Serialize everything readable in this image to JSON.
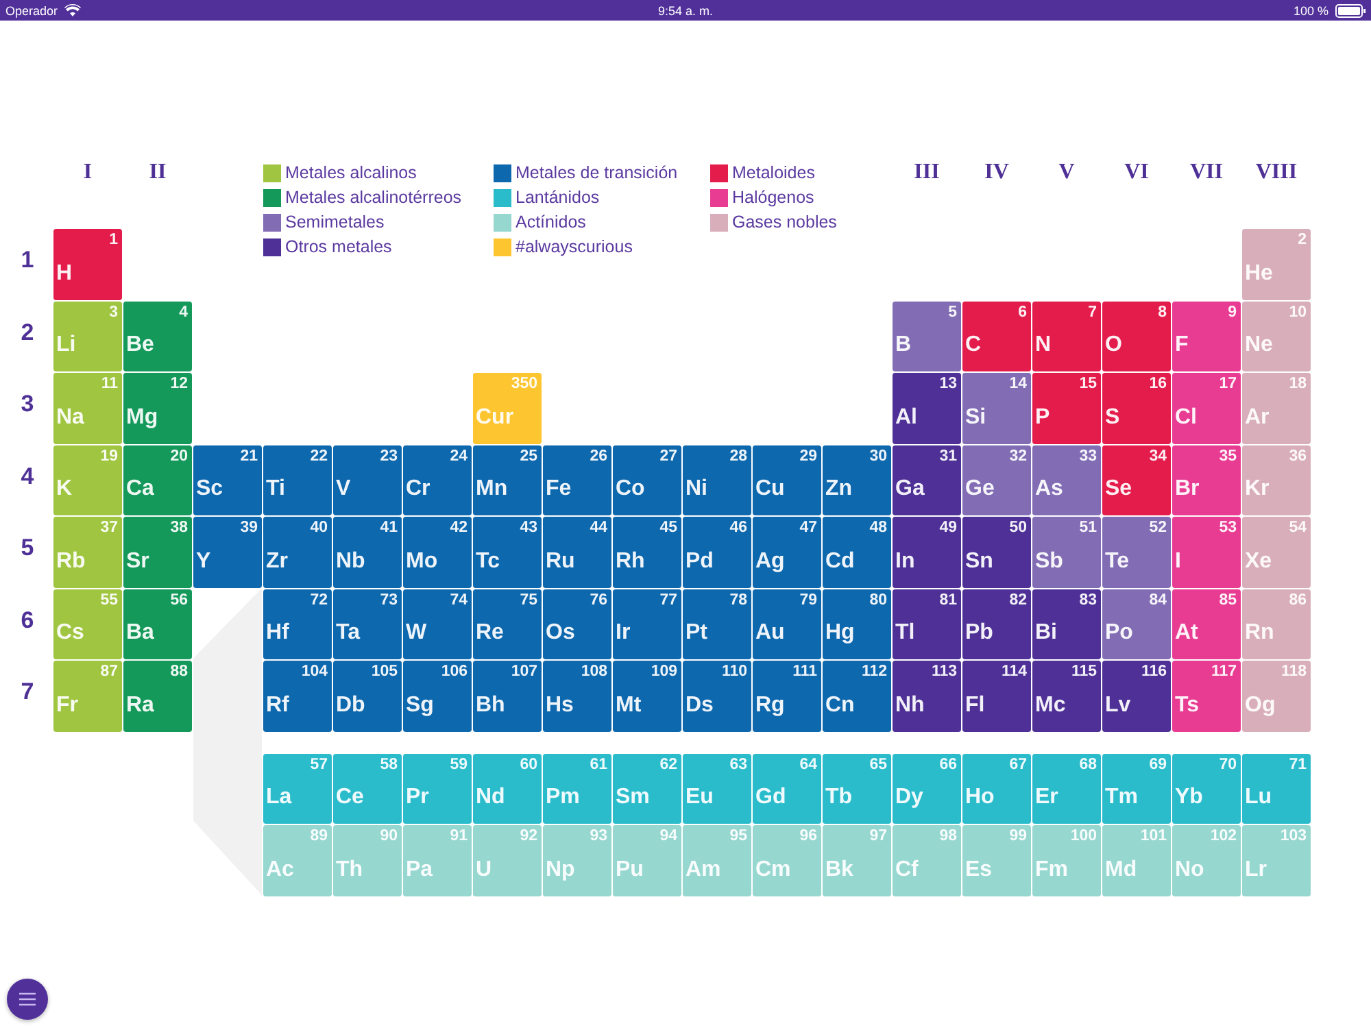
{
  "status_bar": {
    "carrier": "Operador",
    "time": "9:54 a. m.",
    "battery": "100 %"
  },
  "group_labels": {
    "left": [
      "I",
      "II"
    ],
    "right": [
      "III",
      "IV",
      "V",
      "VI",
      "VII",
      "VIII"
    ]
  },
  "legend": [
    {
      "kind": "alkali",
      "label": "Metales alcalinos",
      "color": "#a0c540"
    },
    {
      "kind": "alkaline",
      "label": "Metales alcalinotérreos",
      "color": "#14995b"
    },
    {
      "kind": "semimetal",
      "label": "Semimetales",
      "color": "#826db5"
    },
    {
      "kind": "other",
      "label": "Otros metales",
      "color": "#4e3096"
    },
    {
      "kind": "transition",
      "label": "Metales de transición",
      "color": "#0e68ae"
    },
    {
      "kind": "lanthanide",
      "label": "Lantánidos",
      "color": "#2bbccc"
    },
    {
      "kind": "actinide",
      "label": "Actínidos",
      "color": "#96d7d0"
    },
    {
      "kind": "curious",
      "label": "#alwayscurious",
      "color": "#fdc530"
    },
    {
      "kind": "metalloid",
      "label": "Metaloides",
      "color": "#e41c4c"
    },
    {
      "kind": "halogen",
      "label": "Halógenos",
      "color": "#e83c93"
    },
    {
      "kind": "noble",
      "label": "Gases nobles",
      "color": "#d9aebb"
    }
  ],
  "periods": [
    {
      "label": "1",
      "s_block": [
        {
          "symbol": "H",
          "number": "1",
          "kind": "metalloid"
        }
      ],
      "p_block": [
        {
          "symbol": "He",
          "number": "2",
          "kind": "noble"
        }
      ]
    },
    {
      "label": "2",
      "s_block": [
        {
          "symbol": "Li",
          "number": "3",
          "kind": "alkali"
        },
        {
          "symbol": "Be",
          "number": "4",
          "kind": "alkaline"
        }
      ],
      "p_block": [
        {
          "symbol": "B",
          "number": "5",
          "kind": "semimetal"
        },
        {
          "symbol": "C",
          "number": "6",
          "kind": "metalloid"
        },
        {
          "symbol": "N",
          "number": "7",
          "kind": "metalloid"
        },
        {
          "symbol": "O",
          "number": "8",
          "kind": "metalloid"
        },
        {
          "symbol": "F",
          "number": "9",
          "kind": "halogen"
        },
        {
          "symbol": "Ne",
          "number": "10",
          "kind": "noble"
        }
      ]
    },
    {
      "label": "3",
      "s_block": [
        {
          "symbol": "Na",
          "number": "11",
          "kind": "alkali"
        },
        {
          "symbol": "Mg",
          "number": "12",
          "kind": "alkaline"
        }
      ],
      "d_block": [
        {
          "kind": "gap"
        },
        {
          "kind": "gap"
        },
        {
          "kind": "gap"
        },
        {
          "kind": "gap"
        },
        {
          "symbol": "Cur",
          "number": "350",
          "kind": "curious"
        }
      ],
      "p_block": [
        {
          "symbol": "Al",
          "number": "13",
          "kind": "other"
        },
        {
          "symbol": "Si",
          "number": "14",
          "kind": "semimetal"
        },
        {
          "symbol": "P",
          "number": "15",
          "kind": "metalloid"
        },
        {
          "symbol": "S",
          "number": "16",
          "kind": "metalloid"
        },
        {
          "symbol": "Cl",
          "number": "17",
          "kind": "halogen"
        },
        {
          "symbol": "Ar",
          "number": "18",
          "kind": "noble"
        }
      ]
    },
    {
      "label": "4",
      "s_block": [
        {
          "symbol": "K",
          "number": "19",
          "kind": "alkali"
        },
        {
          "symbol": "Ca",
          "number": "20",
          "kind": "alkaline"
        }
      ],
      "d_block": [
        {
          "symbol": "Sc",
          "number": "21",
          "kind": "transition"
        },
        {
          "symbol": "Ti",
          "number": "22",
          "kind": "transition"
        },
        {
          "symbol": "V",
          "number": "23",
          "kind": "transition"
        },
        {
          "symbol": "Cr",
          "number": "24",
          "kind": "transition"
        },
        {
          "symbol": "Mn",
          "number": "25",
          "kind": "transition"
        },
        {
          "symbol": "Fe",
          "number": "26",
          "kind": "transition"
        },
        {
          "symbol": "Co",
          "number": "27",
          "kind": "transition"
        },
        {
          "symbol": "Ni",
          "number": "28",
          "kind": "transition"
        },
        {
          "symbol": "Cu",
          "number": "29",
          "kind": "transition"
        },
        {
          "symbol": "Zn",
          "number": "30",
          "kind": "transition"
        }
      ],
      "p_block": [
        {
          "symbol": "Ga",
          "number": "31",
          "kind": "other"
        },
        {
          "symbol": "Ge",
          "number": "32",
          "kind": "semimetal"
        },
        {
          "symbol": "As",
          "number": "33",
          "kind": "semimetal"
        },
        {
          "symbol": "Se",
          "number": "34",
          "kind": "metalloid"
        },
        {
          "symbol": "Br",
          "number": "35",
          "kind": "halogen"
        },
        {
          "symbol": "Kr",
          "number": "36",
          "kind": "noble"
        }
      ]
    },
    {
      "label": "5",
      "s_block": [
        {
          "symbol": "Rb",
          "number": "37",
          "kind": "alkali"
        },
        {
          "symbol": "Sr",
          "number": "38",
          "kind": "alkaline"
        }
      ],
      "d_block": [
        {
          "symbol": "Y",
          "number": "39",
          "kind": "transition"
        },
        {
          "symbol": "Zr",
          "number": "40",
          "kind": "transition"
        },
        {
          "symbol": "Nb",
          "number": "41",
          "kind": "transition"
        },
        {
          "symbol": "Mo",
          "number": "42",
          "kind": "transition"
        },
        {
          "symbol": "Tc",
          "number": "43",
          "kind": "transition"
        },
        {
          "symbol": "Ru",
          "number": "44",
          "kind": "transition"
        },
        {
          "symbol": "Rh",
          "number": "45",
          "kind": "transition"
        },
        {
          "symbol": "Pd",
          "number": "46",
          "kind": "transition"
        },
        {
          "symbol": "Ag",
          "number": "47",
          "kind": "transition"
        },
        {
          "symbol": "Cd",
          "number": "48",
          "kind": "transition"
        }
      ],
      "p_block": [
        {
          "symbol": "In",
          "number": "49",
          "kind": "other"
        },
        {
          "symbol": "Sn",
          "number": "50",
          "kind": "other"
        },
        {
          "symbol": "Sb",
          "number": "51",
          "kind": "semimetal"
        },
        {
          "symbol": "Te",
          "number": "52",
          "kind": "semimetal"
        },
        {
          "symbol": "I",
          "number": "53",
          "kind": "halogen"
        },
        {
          "symbol": "Xe",
          "number": "54",
          "kind": "noble"
        }
      ]
    },
    {
      "label": "6",
      "s_block": [
        {
          "symbol": "Cs",
          "number": "55",
          "kind": "alkali"
        },
        {
          "symbol": "Ba",
          "number": "56",
          "kind": "alkaline"
        }
      ],
      "d_block": [
        {
          "kind": "gap"
        },
        {
          "symbol": "Hf",
          "number": "72",
          "kind": "transition"
        },
        {
          "symbol": "Ta",
          "number": "73",
          "kind": "transition"
        },
        {
          "symbol": "W",
          "number": "74",
          "kind": "transition"
        },
        {
          "symbol": "Re",
          "number": "75",
          "kind": "transition"
        },
        {
          "symbol": "Os",
          "number": "76",
          "kind": "transition"
        },
        {
          "symbol": "Ir",
          "number": "77",
          "kind": "transition"
        },
        {
          "symbol": "Pt",
          "number": "78",
          "kind": "transition"
        },
        {
          "symbol": "Au",
          "number": "79",
          "kind": "transition"
        },
        {
          "symbol": "Hg",
          "number": "80",
          "kind": "transition"
        }
      ],
      "p_block": [
        {
          "symbol": "Tl",
          "number": "81",
          "kind": "other"
        },
        {
          "symbol": "Pb",
          "number": "82",
          "kind": "other"
        },
        {
          "symbol": "Bi",
          "number": "83",
          "kind": "other"
        },
        {
          "symbol": "Po",
          "number": "84",
          "kind": "semimetal"
        },
        {
          "symbol": "At",
          "number": "85",
          "kind": "halogen"
        },
        {
          "symbol": "Rn",
          "number": "86",
          "kind": "noble"
        }
      ]
    },
    {
      "label": "7",
      "s_block": [
        {
          "symbol": "Fr",
          "number": "87",
          "kind": "alkali"
        },
        {
          "symbol": "Ra",
          "number": "88",
          "kind": "alkaline"
        }
      ],
      "d_block": [
        {
          "kind": "gap"
        },
        {
          "symbol": "Rf",
          "number": "104",
          "kind": "transition"
        },
        {
          "symbol": "Db",
          "number": "105",
          "kind": "transition"
        },
        {
          "symbol": "Sg",
          "number": "106",
          "kind": "transition"
        },
        {
          "symbol": "Bh",
          "number": "107",
          "kind": "transition"
        },
        {
          "symbol": "Hs",
          "number": "108",
          "kind": "transition"
        },
        {
          "symbol": "Mt",
          "number": "109",
          "kind": "transition"
        },
        {
          "symbol": "Ds",
          "number": "110",
          "kind": "transition"
        },
        {
          "symbol": "Rg",
          "number": "111",
          "kind": "transition"
        },
        {
          "symbol": "Cn",
          "number": "112",
          "kind": "transition"
        }
      ],
      "p_block": [
        {
          "symbol": "Nh",
          "number": "113",
          "kind": "other"
        },
        {
          "symbol": "Fl",
          "number": "114",
          "kind": "other"
        },
        {
          "symbol": "Mc",
          "number": "115",
          "kind": "other"
        },
        {
          "symbol": "Lv",
          "number": "116",
          "kind": "other"
        },
        {
          "symbol": "Ts",
          "number": "117",
          "kind": "halogen"
        },
        {
          "symbol": "Og",
          "number": "118",
          "kind": "noble"
        }
      ]
    }
  ],
  "f_series": [
    {
      "elements": [
        {
          "symbol": "La",
          "number": "57",
          "kind": "lanthanide"
        },
        {
          "symbol": "Ce",
          "number": "58",
          "kind": "lanthanide"
        },
        {
          "symbol": "Pr",
          "number": "59",
          "kind": "lanthanide"
        },
        {
          "symbol": "Nd",
          "number": "60",
          "kind": "lanthanide"
        },
        {
          "symbol": "Pm",
          "number": "61",
          "kind": "lanthanide"
        },
        {
          "symbol": "Sm",
          "number": "62",
          "kind": "lanthanide"
        },
        {
          "symbol": "Eu",
          "number": "63",
          "kind": "lanthanide"
        },
        {
          "symbol": "Gd",
          "number": "64",
          "kind": "lanthanide"
        },
        {
          "symbol": "Tb",
          "number": "65",
          "kind": "lanthanide"
        },
        {
          "symbol": "Dy",
          "number": "66",
          "kind": "lanthanide"
        },
        {
          "symbol": "Ho",
          "number": "67",
          "kind": "lanthanide"
        },
        {
          "symbol": "Er",
          "number": "68",
          "kind": "lanthanide"
        },
        {
          "symbol": "Tm",
          "number": "69",
          "kind": "lanthanide"
        },
        {
          "symbol": "Yb",
          "number": "70",
          "kind": "lanthanide"
        },
        {
          "symbol": "Lu",
          "number": "71",
          "kind": "lanthanide"
        }
      ]
    },
    {
      "elements": [
        {
          "symbol": "Ac",
          "number": "89",
          "kind": "actinide"
        },
        {
          "symbol": "Th",
          "number": "90",
          "kind": "actinide"
        },
        {
          "symbol": "Pa",
          "number": "91",
          "kind": "actinide"
        },
        {
          "symbol": "U",
          "number": "92",
          "kind": "actinide"
        },
        {
          "symbol": "Np",
          "number": "93",
          "kind": "actinide"
        },
        {
          "symbol": "Pu",
          "number": "94",
          "kind": "actinide"
        },
        {
          "symbol": "Am",
          "number": "95",
          "kind": "actinide"
        },
        {
          "symbol": "Cm",
          "number": "96",
          "kind": "actinide"
        },
        {
          "symbol": "Bk",
          "number": "97",
          "kind": "actinide"
        },
        {
          "symbol": "Cf",
          "number": "98",
          "kind": "actinide"
        },
        {
          "symbol": "Es",
          "number": "99",
          "kind": "actinide"
        },
        {
          "symbol": "Fm",
          "number": "100",
          "kind": "actinide"
        },
        {
          "symbol": "Md",
          "number": "101",
          "kind": "actinide"
        },
        {
          "symbol": "No",
          "number": "102",
          "kind": "actinide"
        },
        {
          "symbol": "Lr",
          "number": "103",
          "kind": "actinide"
        }
      ]
    }
  ]
}
